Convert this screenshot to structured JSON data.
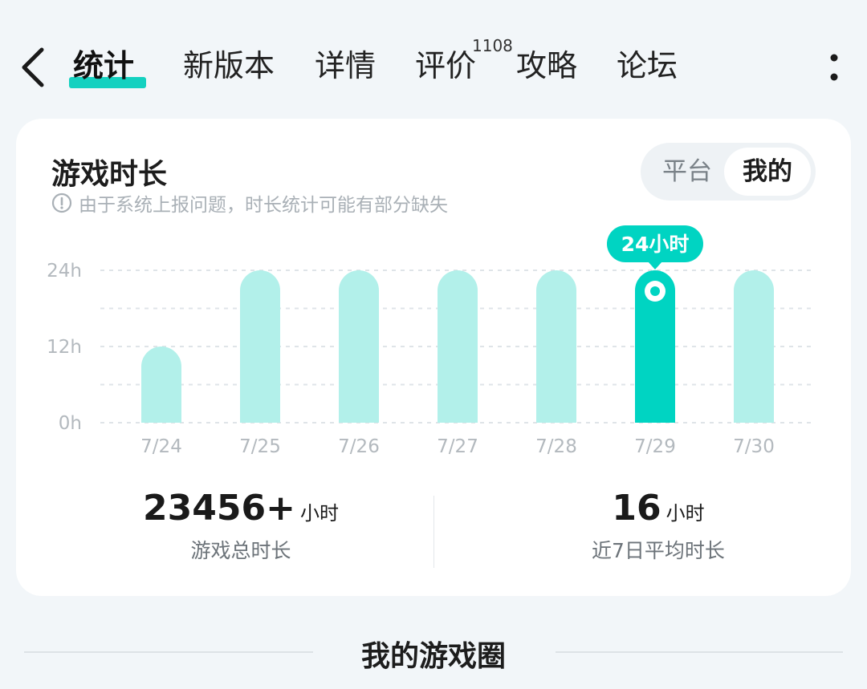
{
  "nav": {
    "tabs": [
      {
        "label": "统计",
        "active": true
      },
      {
        "label": "新版本"
      },
      {
        "label": "详情"
      },
      {
        "label": "评价",
        "badge": "1108"
      },
      {
        "label": "攻略"
      },
      {
        "label": "论坛"
      }
    ],
    "icons": {
      "back": "chevron-left-icon",
      "more": "more-vertical-icon"
    }
  },
  "card": {
    "title": "游戏时长",
    "notice": "由于系统上报问题，时长统计可能有部分缺失",
    "toggle": {
      "options": [
        "平台",
        "我的"
      ],
      "selected": "我的"
    }
  },
  "chart_data": {
    "type": "bar",
    "categories": [
      "7/24",
      "7/25",
      "7/26",
      "7/27",
      "7/28",
      "7/29",
      "7/30"
    ],
    "series": [
      {
        "values": [
          12,
          24,
          24,
          24,
          24,
          24,
          24
        ]
      }
    ],
    "yticks": [
      "0h",
      "12h",
      "24h"
    ],
    "ylim": [
      0,
      24
    ],
    "grid": true,
    "highlight": {
      "index": 5,
      "label": "24小时"
    }
  },
  "stats": {
    "total": {
      "value": "23456+",
      "unit": "小时",
      "label": "游戏总时长"
    },
    "average": {
      "value": "16",
      "unit": "小时",
      "label": "近7日平均时长"
    }
  },
  "section": {
    "title": "我的游戏圈"
  },
  "colors": {
    "accent": "#14d1c0",
    "bar": "#b2f0ea",
    "bar_selected": "#00d4c2"
  }
}
